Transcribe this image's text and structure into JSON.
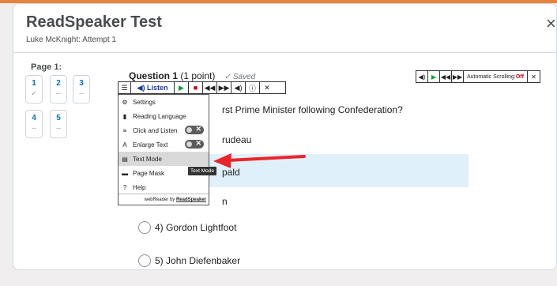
{
  "dialog": {
    "title": "ReadSpeaker Test",
    "subtitle": "Luke McKnight: Attempt 1",
    "close_glyph": "×"
  },
  "sidebar": {
    "page_label": "Page 1:",
    "questions": [
      {
        "num": "1",
        "status": "✓"
      },
      {
        "num": "2",
        "status": "--"
      },
      {
        "num": "3",
        "status": "--"
      },
      {
        "num": "4",
        "status": "--"
      },
      {
        "num": "5",
        "status": "--"
      }
    ]
  },
  "question": {
    "label": "Question 1",
    "points": "(1 point)",
    "saved": "✓ Saved",
    "text_partial": "rst Prime Minister following Confederation?",
    "options": [
      {
        "num": "",
        "text": "rudeau"
      },
      {
        "num": "",
        "text": "pald"
      },
      {
        "num": "",
        "text": "n"
      },
      {
        "num": "4)",
        "text": "Gordon Lightfoot"
      },
      {
        "num": "5)",
        "text": "John Diefenbaker"
      }
    ]
  },
  "rs_toolbar": {
    "listen_label": "Listen",
    "info_glyph": "ⓘ",
    "close_glyph": "✕"
  },
  "rs_menu": {
    "items": [
      {
        "label": "Settings",
        "icon": "gear-icon"
      },
      {
        "label": "Reading Language",
        "icon": "language-icon"
      },
      {
        "label": "Click and Listen",
        "icon": "click-listen-icon",
        "toggle": "off"
      },
      {
        "label": "Enlarge Text",
        "icon": "enlarge-text-icon",
        "toggle": "off"
      },
      {
        "label": "Text Mode",
        "icon": "text-mode-icon"
      },
      {
        "label": "Page Mask",
        "icon": "page-mask-icon"
      },
      {
        "label": "Help",
        "icon": "help-icon"
      }
    ],
    "footer_prefix": "webReader by ",
    "footer_brand": "ReadSpeaker",
    "tooltip": "Text Mode"
  },
  "mini_bar": {
    "auto_scroll_label": "Automatic Scrolling: ",
    "auto_scroll_state": "Off",
    "close_glyph": "✕"
  },
  "colors": {
    "accent": "#e9823a",
    "link": "#006fbf",
    "arrow": "#e8262a",
    "highlight": "#e0f0fb"
  }
}
